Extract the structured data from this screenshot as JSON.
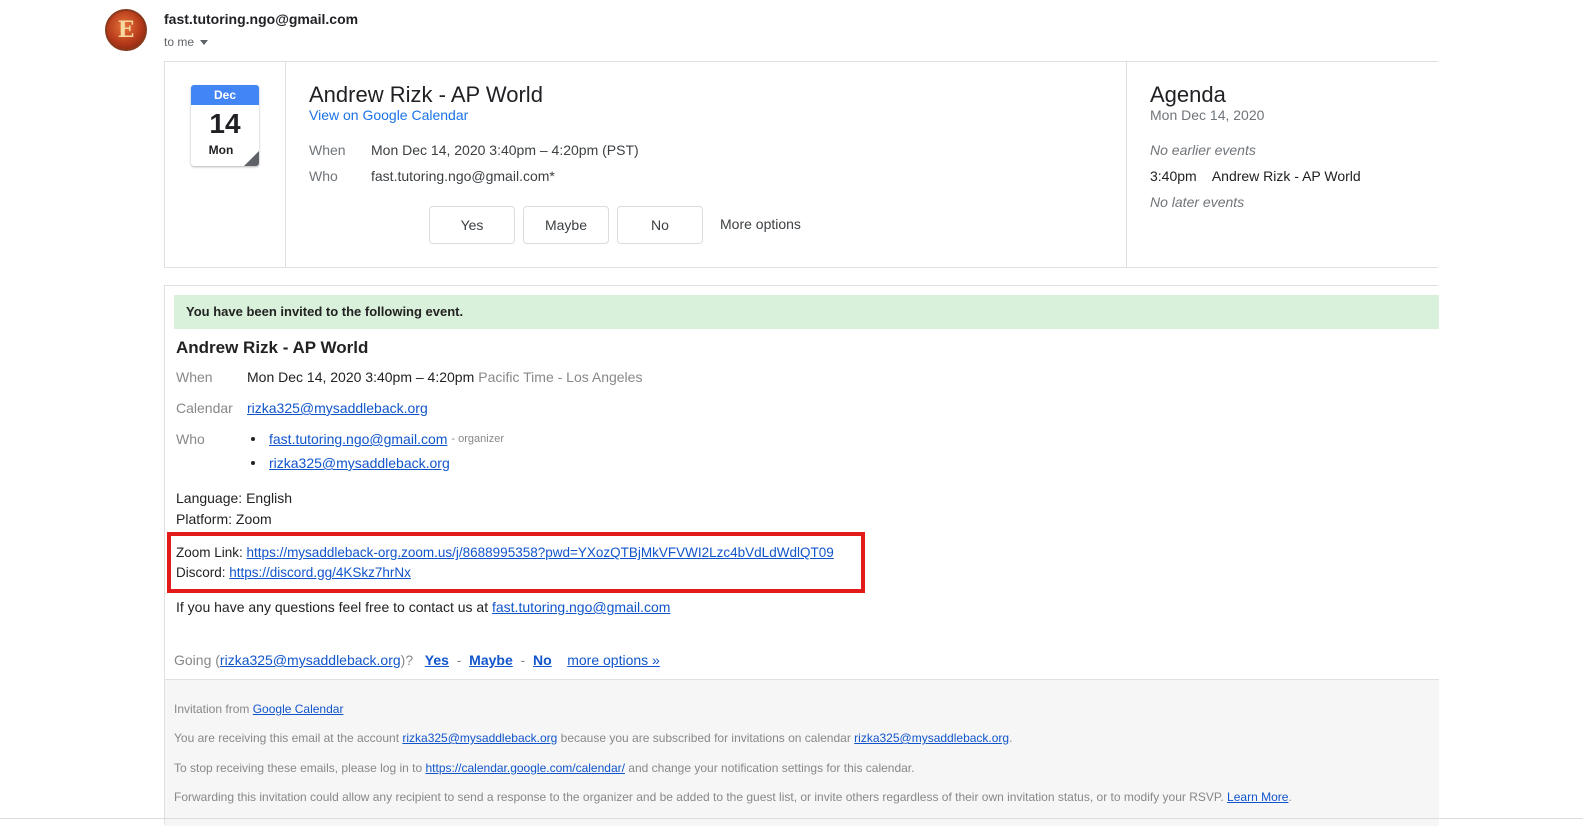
{
  "header": {
    "avatar_letter": "E",
    "sender": "fast.tutoring.ngo@gmail.com",
    "recipient": "to me"
  },
  "card": {
    "calendar": {
      "month": "Dec",
      "day": "14",
      "weekday": "Mon"
    },
    "title": "Andrew Rizk - AP World",
    "view_link": "View on Google Calendar",
    "when_label": "When",
    "when_value": "Mon Dec 14, 2020 3:40pm – 4:20pm (PST)",
    "who_label": "Who",
    "who_value": "fast.tutoring.ngo@gmail.com*",
    "rsvp": {
      "yes": "Yes",
      "maybe": "Maybe",
      "no": "No",
      "more": "More options"
    }
  },
  "agenda": {
    "title": "Agenda",
    "date": "Mon Dec 14, 2020",
    "no_earlier": "No earlier events",
    "event_time": "3:40pm",
    "event_title": "Andrew Rizk - AP World",
    "no_later": "No later events"
  },
  "invite": {
    "banner": "You have been invited to the following event.",
    "title": "Andrew Rizk - AP World",
    "when_label": "When",
    "when_value": "Mon Dec 14, 2020 3:40pm – 4:20pm",
    "when_tz": "Pacific Time - Los Angeles",
    "calendar_label": "Calendar",
    "calendar_value": "rizka325@mysaddleback.org",
    "who_label": "Who",
    "guests": [
      {
        "email": "fast.tutoring.ngo@gmail.com",
        "role": "- organizer"
      },
      {
        "email": "rizka325@mysaddleback.org",
        "role": ""
      }
    ],
    "language": "Language: English",
    "platform": "Platform: Zoom",
    "zoom_label": "Zoom Link:",
    "zoom_url": "https://mysaddleback-org.zoom.us/j/8688995358?pwd=YXozQTBjMkVFVWI2Lzc4bVdLdWdlQT09",
    "discord_label": "Discord:",
    "discord_url": "https://discord.gg/4KSkz7hrNx",
    "questions_text": "If you have any questions feel free to contact us at",
    "questions_email": "fast.tutoring.ngo@gmail.com",
    "going_prefix": "Going (",
    "going_email": "rizka325@mysaddleback.org",
    "going_suffix": ")?",
    "going_yes": "Yes",
    "going_maybe": "Maybe",
    "going_no": "No",
    "going_sep": "-",
    "going_more": "more options »"
  },
  "footer": {
    "invitation_from": "Invitation from",
    "google_calendar": "Google Calendar",
    "receiving_1": "You are receiving this email at the account",
    "receiving_email": "rizka325@mysaddleback.org",
    "receiving_2": "because you are subscribed for invitations on calendar",
    "receiving_calendar": "rizka325@mysaddleback.org",
    "receiving_end": ".",
    "stop_1": "To stop receiving these emails, please log in to",
    "stop_link": "https://calendar.google.com/calendar/",
    "stop_2": "and change your notification settings for this calendar.",
    "forwarding": "Forwarding this invitation could allow any recipient to send a response to the organizer and be added to the guest list, or invite others regardless of their own invitation status, or to modify your RSVP.",
    "learn_more": "Learn More",
    "forwarding_end": "."
  },
  "colors": {
    "link": "#1155cc",
    "google_blue": "#4285f4",
    "banner_green": "#d9f0da",
    "highlight_red": "#e21a1a"
  }
}
